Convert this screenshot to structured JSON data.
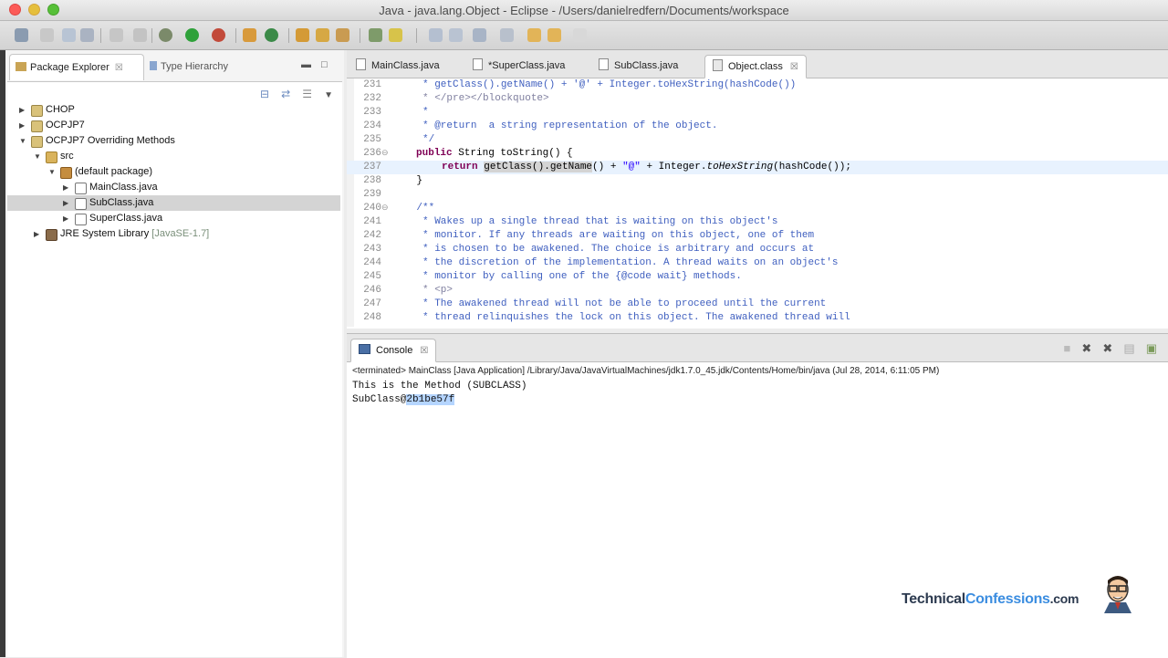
{
  "window": {
    "title": "Java - java.lang.Object - Eclipse - /Users/danielredfern/Documents/workspace"
  },
  "left_tabs": [
    {
      "label": "Package Explorer",
      "close": "☒"
    },
    {
      "label": "Type Hierarchy"
    }
  ],
  "tree": [
    {
      "label": "CHOP",
      "depth": 0,
      "expanded": false,
      "icon": "project-icon"
    },
    {
      "label": "OCPJP7",
      "depth": 0,
      "expanded": false,
      "icon": "project-icon"
    },
    {
      "label": "OCPJP7 Overriding Methods",
      "depth": 0,
      "expanded": true,
      "icon": "project-icon"
    },
    {
      "label": "src",
      "depth": 1,
      "expanded": true,
      "icon": "source-folder-icon"
    },
    {
      "label": "(default package)",
      "depth": 2,
      "expanded": true,
      "icon": "package-icon"
    },
    {
      "label": "MainClass.java",
      "depth": 3,
      "expanded": false,
      "icon": "java-file-icon"
    },
    {
      "label": "SubClass.java",
      "depth": 3,
      "expanded": false,
      "icon": "java-file-icon",
      "selected": true
    },
    {
      "label": "SuperClass.java",
      "depth": 3,
      "expanded": false,
      "icon": "java-file-icon"
    },
    {
      "label": "JRE System Library",
      "decoration": "[JavaSE-1.7]",
      "depth": 1,
      "expanded": false,
      "icon": "library-icon"
    }
  ],
  "editor_tabs": [
    {
      "label": "MainClass.java",
      "active": false
    },
    {
      "label": "*SuperClass.java",
      "active": false
    },
    {
      "label": "SubClass.java",
      "active": false
    },
    {
      "label": "Object.class",
      "active": true,
      "close": "☒"
    }
  ],
  "code_lines": [
    {
      "num": "231",
      "text": "     * getClass().getName() + '@' + Integer.toHexString(hashCode())"
    },
    {
      "num": "232",
      "text": "     * </pre></blockquote>"
    },
    {
      "num": "233",
      "text": "     *"
    },
    {
      "num": "234",
      "text": "     * @return  a string representation of the object."
    },
    {
      "num": "235",
      "text": "     */"
    },
    {
      "num": "236",
      "text": "public String toString() {",
      "fold": "⊖"
    },
    {
      "num": "237",
      "text": "return getClass().getName() + \"@\" + Integer.toHexString(hashCode());",
      "current": true
    },
    {
      "num": "238",
      "text": "    }"
    },
    {
      "num": "239",
      "text": ""
    },
    {
      "num": "240",
      "text": "    /**",
      "fold": "⊖"
    },
    {
      "num": "241",
      "text": "     * Wakes up a single thread that is waiting on this object's"
    },
    {
      "num": "242",
      "text": "     * monitor. If any threads are waiting on this object, one of them"
    },
    {
      "num": "243",
      "text": "     * is chosen to be awakened. The choice is arbitrary and occurs at"
    },
    {
      "num": "244",
      "text": "     * the discretion of the implementation. A thread waits on an object's"
    },
    {
      "num": "245",
      "text": "     * monitor by calling one of the {@code wait} methods."
    },
    {
      "num": "246",
      "text": "     * <p>"
    },
    {
      "num": "247",
      "text": "     * The awakened thread will not be able to proceed until the current"
    },
    {
      "num": "248",
      "text": "     * thread relinquishes the lock on this object. The awakened thread will"
    }
  ],
  "console": {
    "tab_label": "Console",
    "close": "☒",
    "terminated": "<terminated> MainClass [Java Application] /Library/Java/JavaVirtualMachines/jdk1.7.0_45.jdk/Contents/Home/bin/java (Jul 28, 2014, 6:11:05 PM)",
    "line1": "This is the Method (SUBCLASS)",
    "line2_prefix": "SubClass@",
    "line2_selected": "2b1be57f"
  },
  "logo": {
    "part1": "Technical",
    "part2": "Confessions",
    "part3": ".com"
  },
  "colors": {
    "keyword": "#7f0055",
    "javadoc": "#3f5fbf",
    "string": "#2a00ff",
    "selection": "#b5d5ff"
  }
}
